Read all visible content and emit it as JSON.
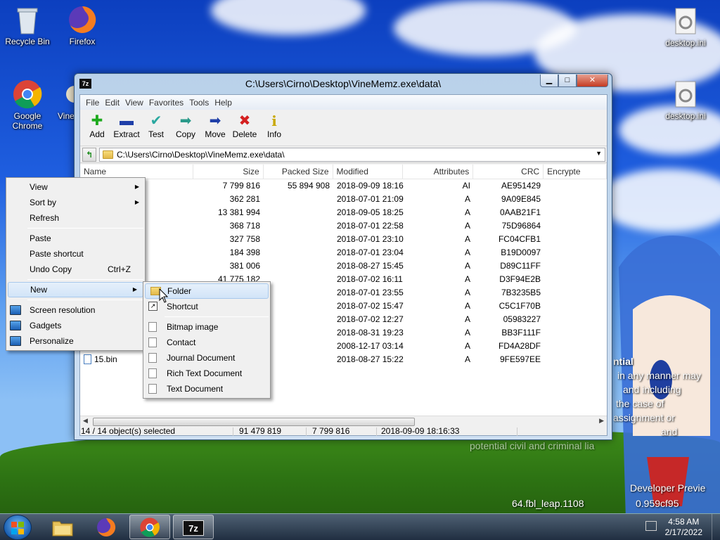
{
  "desktop": {
    "icons": [
      {
        "label": "Recycle Bin",
        "icon": "recycle-bin-icon"
      },
      {
        "label": "Firefox",
        "icon": "firefox-icon"
      },
      {
        "label": "Google Chrome",
        "icon": "chrome-icon"
      },
      {
        "label": "Vine",
        "icon": "vine-icon"
      },
      {
        "label": "desktop.ini",
        "icon": "settings-file-icon"
      },
      {
        "label": "desktop.ini",
        "icon": "settings-file-icon"
      }
    ],
    "wallpaper_text": [
      "ntial",
      "in any manner may",
      "and including",
      "the case of",
      "assignment or",
      "and",
      "potential civil and criminal lia",
      "Developer Previe",
      "64.fbl_leap.1108",
      "0.959cf95"
    ]
  },
  "window": {
    "title": "C:\\Users\\Cirno\\Desktop\\VineMemz.exe\\data\\",
    "app_icon_text": "7z",
    "controls": {
      "minimize": "▁",
      "maximize": "□",
      "close": "✕"
    },
    "menu": [
      "File",
      "Edit",
      "View",
      "Favorites",
      "Tools",
      "Help"
    ],
    "toolbar": [
      {
        "label": "Add",
        "icon": "plus-icon",
        "glyph": "✚",
        "color": "#1eaa1e"
      },
      {
        "label": "Extract",
        "icon": "minus-icon",
        "glyph": "▬",
        "color": "#1f3fa8"
      },
      {
        "label": "Test",
        "icon": "check-icon",
        "glyph": "✔",
        "color": "#2aa8a0"
      },
      {
        "label": "Copy",
        "icon": "copy-arrow-icon",
        "glyph": "➡",
        "color": "#2a9a8a"
      },
      {
        "label": "Move",
        "icon": "move-arrow-icon",
        "glyph": "➡",
        "color": "#1f3fa8"
      },
      {
        "label": "Delete",
        "icon": "delete-x-icon",
        "glyph": "✖",
        "color": "#d42020"
      },
      {
        "label": "Info",
        "icon": "info-icon",
        "glyph": "i",
        "color": "#c8a800"
      }
    ],
    "address": "C:\\Users\\Cirno\\Desktop\\VineMemz.exe\\data\\",
    "columns": [
      "Name",
      "Size",
      "Packed Size",
      "Modified",
      "Attributes",
      "CRC",
      "Encrypte"
    ],
    "rows": [
      {
        "name": "",
        "size": "7 799 816",
        "packed": "55 894 908",
        "modified": "2018-09-09 18:16",
        "attr": "AI",
        "crc": "AE951429"
      },
      {
        "name": "",
        "size": "362 281",
        "packed": "",
        "modified": "2018-07-01 21:09",
        "attr": "A",
        "crc": "9A09E845"
      },
      {
        "name": "",
        "size": "13 381 994",
        "packed": "",
        "modified": "2018-09-05 18:25",
        "attr": "A",
        "crc": "0AAB21F1"
      },
      {
        "name": "",
        "size": "368 718",
        "packed": "",
        "modified": "2018-07-01 22:58",
        "attr": "A",
        "crc": "75D96864"
      },
      {
        "name": "",
        "size": "327 758",
        "packed": "",
        "modified": "2018-07-01 23:10",
        "attr": "A",
        "crc": "FC04CFB1"
      },
      {
        "name": "",
        "size": "184 398",
        "packed": "",
        "modified": "2018-07-01 23:04",
        "attr": "A",
        "crc": "B19D0097"
      },
      {
        "name": "",
        "size": "381 006",
        "packed": "",
        "modified": "2018-08-27 15:45",
        "attr": "A",
        "crc": "D89C11FF"
      },
      {
        "name": "",
        "size": "41 775 182",
        "packed": "",
        "modified": "2018-07-02 16:11",
        "attr": "A",
        "crc": "D3F94E2B"
      },
      {
        "name": "",
        "size": "",
        "packed": "",
        "modified": "2018-07-01 23:55",
        "attr": "A",
        "crc": "7B3235B5"
      },
      {
        "name": "",
        "size": "",
        "packed": "",
        "modified": "2018-07-02 15:47",
        "attr": "A",
        "crc": "C5C1F70B"
      },
      {
        "name": "",
        "size": "",
        "packed": "",
        "modified": "2018-07-02 12:27",
        "attr": "A",
        "crc": "05983227"
      },
      {
        "name": "",
        "size": "",
        "packed": "",
        "modified": "2018-08-31 19:23",
        "attr": "A",
        "crc": "BB3F111F"
      },
      {
        "name": "",
        "size": "",
        "packed": "",
        "modified": "2008-12-17 03:14",
        "attr": "A",
        "crc": "FD4A28DF"
      },
      {
        "name": "15.bin",
        "size": "",
        "packed": "",
        "modified": "2018-08-27 15:22",
        "attr": "A",
        "crc": "9FE597EE"
      }
    ],
    "status": [
      "14 / 14 object(s) selected",
      "91 479 819",
      "7 799 816",
      "2018-09-09 18:16:33"
    ]
  },
  "context_menu": {
    "items": [
      {
        "label": "View",
        "submenu": true
      },
      {
        "label": "Sort by",
        "submenu": true
      },
      {
        "label": "Refresh"
      },
      {
        "sep": true
      },
      {
        "label": "Paste"
      },
      {
        "label": "Paste shortcut"
      },
      {
        "label": "Undo Copy",
        "shortcut": "Ctrl+Z"
      },
      {
        "sep": true
      },
      {
        "label": "New",
        "submenu": true,
        "highlight": true
      },
      {
        "sep": true
      },
      {
        "label": "Screen resolution",
        "icon": "monitor-icon"
      },
      {
        "label": "Gadgets",
        "icon": "gadgets-icon"
      },
      {
        "label": "Personalize",
        "icon": "personalize-icon"
      }
    ]
  },
  "new_submenu": {
    "items": [
      {
        "label": "Folder",
        "icon": "folder-icon",
        "highlight": true
      },
      {
        "label": "Shortcut",
        "icon": "shortcut-icon"
      },
      {
        "sep": true
      },
      {
        "label": "Bitmap image",
        "icon": "bitmap-icon"
      },
      {
        "label": "Contact",
        "icon": "contact-icon"
      },
      {
        "label": "Journal Document",
        "icon": "journal-icon"
      },
      {
        "label": "Rich Text Document",
        "icon": "rtf-icon"
      },
      {
        "label": "Text Document",
        "icon": "text-document-icon"
      }
    ]
  },
  "taskbar": {
    "items": [
      {
        "name": "explorer-taskbar-button",
        "glyph": "🗂"
      },
      {
        "name": "firefox-taskbar-button",
        "glyph": "🦊"
      },
      {
        "name": "chrome-taskbar-button",
        "glyph": "◉"
      },
      {
        "name": "7zip-taskbar-button",
        "glyph": "7z"
      }
    ],
    "clock_time": "4:58 AM",
    "clock_date": "2/17/2022"
  }
}
